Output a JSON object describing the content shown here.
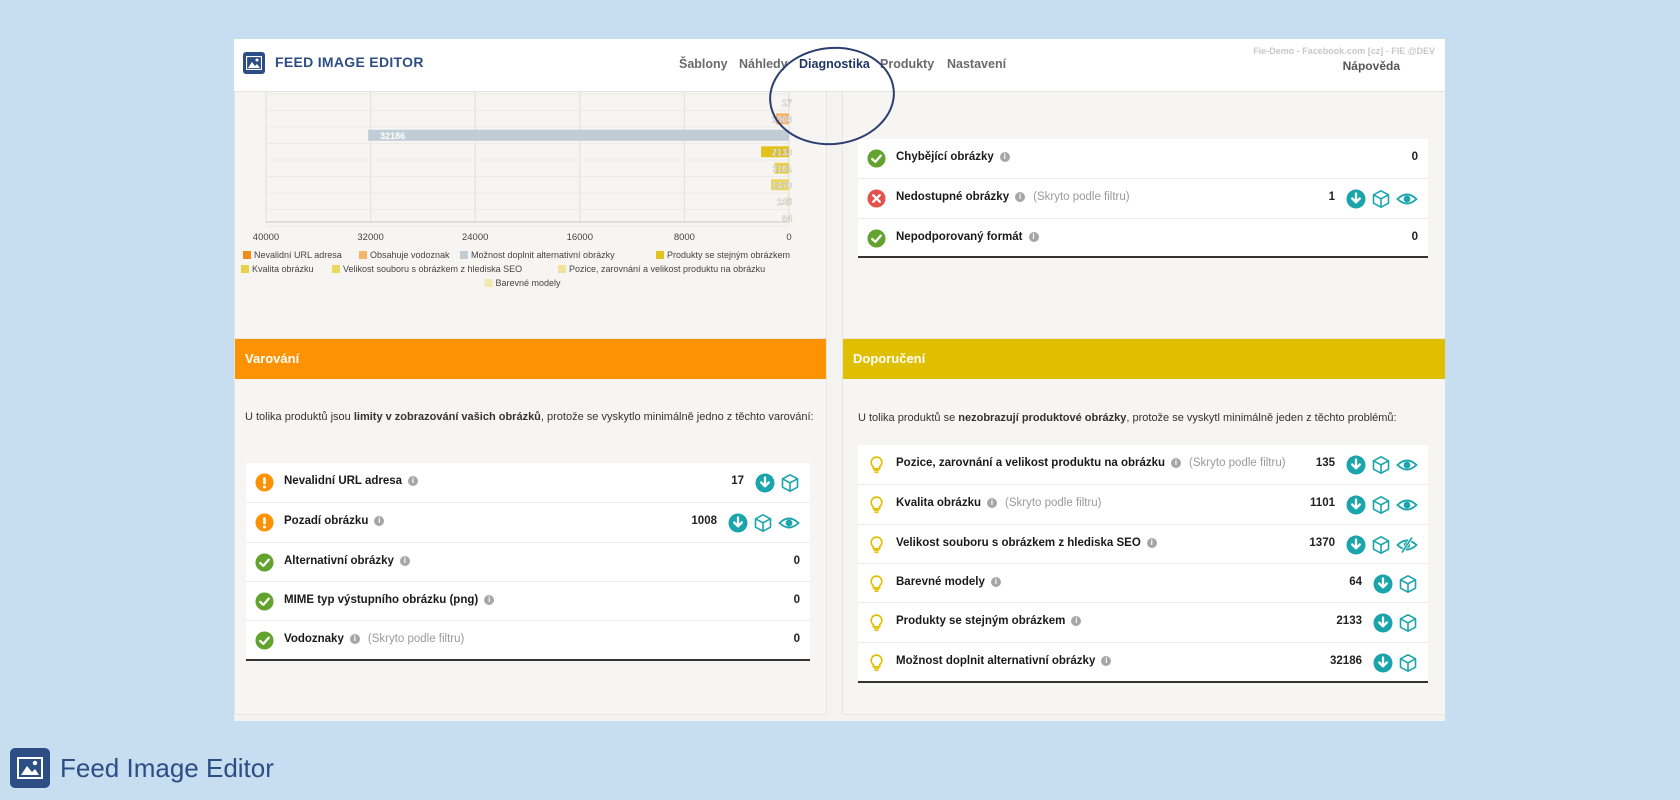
{
  "app": {
    "name": "FEED IMAGE EDITOR",
    "env_info": "Fie-Demo - Facebook.com [cz] - FIE @DEV",
    "help_label": "Nápověda"
  },
  "nav": {
    "items": [
      "Šablony",
      "Náhledy",
      "Diagnostika",
      "Produkty",
      "Nastavení"
    ],
    "active": "Diagnostika"
  },
  "colors": {
    "warning": "#fd9203",
    "recommendation": "#dfbf00",
    "ok": "#62a32e",
    "error": "#e5524e",
    "accent": "#1aa5ad",
    "brand": "#2d4e84"
  },
  "chart_data": {
    "type": "bar",
    "orientation": "horizontal",
    "xlim": [
      40000,
      0
    ],
    "x_ticks": [
      "40000",
      "32000",
      "24000",
      "16000",
      "8000",
      "0"
    ],
    "series": [
      {
        "name": "Nevalidní URL adresa",
        "value": 17,
        "color": "#f08c1a"
      },
      {
        "name": "Obsahuje vodoznak",
        "value": 1008,
        "color": "#f7b46a"
      },
      {
        "name": "Možnost doplnit alternativní obrázky",
        "value": 32186,
        "color": "#c0cdd6"
      },
      {
        "name": "Produkty se stejným obrázkem",
        "value": 2133,
        "color": "#e3c21e"
      },
      {
        "name": "Kvalita obrázku",
        "value": 1101,
        "color": "#e9d14d"
      },
      {
        "name": "Velikost souboru s obrázkem z hlediska SEO",
        "value": 1370,
        "color": "#ecd861"
      },
      {
        "name": "Pozice, zarovnání a velikost produktu na obrázku",
        "value": 135,
        "color": "#f1e39a"
      },
      {
        "name": "Barevné modely",
        "value": 64,
        "color": "#f3e8ae"
      }
    ]
  },
  "errors": {
    "rows": [
      {
        "status": "ok",
        "label": "Chybějící obrázky",
        "note": "",
        "count": "0",
        "actions": []
      },
      {
        "status": "error",
        "label": "Nedostupné obrázky",
        "note": "(Skryto podle filtru)",
        "count": "1",
        "actions": [
          "download",
          "box",
          "eye"
        ]
      },
      {
        "status": "ok",
        "label": "Nepodporovaný formát",
        "note": "",
        "count": "0",
        "actions": []
      }
    ]
  },
  "warnings": {
    "title": "Varování",
    "intro_pre": "U tolika produktů jsou ",
    "intro_bold": "limity v zobrazování vašich obrázků",
    "intro_post": ", protože se vyskytlo minimálně jedno z těchto varování:",
    "rows": [
      {
        "status": "warn",
        "label": "Nevalidní URL adresa",
        "note": "",
        "count": "17",
        "actions": [
          "download",
          "box"
        ]
      },
      {
        "status": "warn",
        "label": "Pozadí obrázku",
        "note": "",
        "count": "1008",
        "actions": [
          "download",
          "box",
          "eye"
        ]
      },
      {
        "status": "ok",
        "label": "Alternativní obrázky",
        "note": "",
        "count": "0",
        "actions": []
      },
      {
        "status": "ok",
        "label": "MIME typ výstupního obrázku (png)",
        "note": "",
        "count": "0",
        "actions": []
      },
      {
        "status": "ok",
        "label": "Vodoznaky",
        "note": "(Skryto podle filtru)",
        "count": "0",
        "actions": []
      }
    ]
  },
  "recommendations": {
    "title": "Doporučení",
    "intro_pre": "U tolika produktů se ",
    "intro_bold": "nezobrazují produktové obrázky",
    "intro_post": ", protože se vyskytl minimálně jeden z těchto problémů:",
    "rows": [
      {
        "status": "bulb",
        "label": "Pozice, zarovnání a velikost produktu na obrázku",
        "note": "(Skryto podle filtru)",
        "count": "135",
        "actions": [
          "download",
          "box",
          "eye"
        ]
      },
      {
        "status": "bulb",
        "label": "Kvalita obrázku",
        "note": "(Skryto podle filtru)",
        "count": "1101",
        "actions": [
          "download",
          "box",
          "eye"
        ]
      },
      {
        "status": "bulb",
        "label": "Velikost souboru s obrázkem z hlediska SEO",
        "note": "",
        "count": "1370",
        "actions": [
          "download",
          "box",
          "eye-off"
        ]
      },
      {
        "status": "bulb",
        "label": "Barevné modely",
        "note": "",
        "count": "64",
        "actions": [
          "download",
          "box"
        ]
      },
      {
        "status": "bulb",
        "label": "Produkty se stejným obrázkem",
        "note": "",
        "count": "2133",
        "actions": [
          "download",
          "box"
        ]
      },
      {
        "status": "bulb",
        "label": "Možnost doplnit alternativní obrázky",
        "note": "",
        "count": "32186",
        "actions": [
          "download",
          "box"
        ]
      }
    ]
  },
  "footer_brand": "Feed Image Editor"
}
